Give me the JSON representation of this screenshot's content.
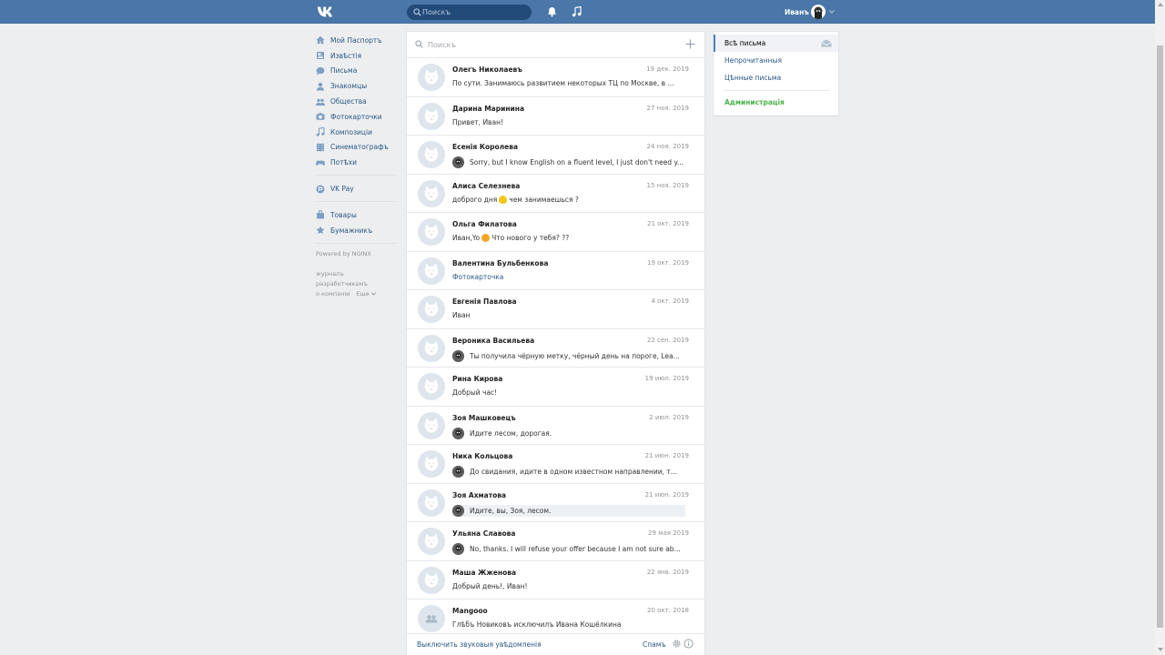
{
  "header": {
    "search_placeholder": "Поискъ",
    "user_name": "Иванъ"
  },
  "sidebar": {
    "items": [
      {
        "label": "Мой Паспортъ",
        "icon": "home-icon"
      },
      {
        "label": "Извѣстія",
        "icon": "news-icon"
      },
      {
        "label": "Письма",
        "icon": "messages-icon"
      },
      {
        "label": "Знакомцы",
        "icon": "friends-icon"
      },
      {
        "label": "Общества",
        "icon": "groups-icon"
      },
      {
        "label": "Фотокарточки",
        "icon": "camera-icon"
      },
      {
        "label": "Композиціи",
        "icon": "music-icon"
      },
      {
        "label": "Синематографъ",
        "icon": "video-icon"
      },
      {
        "label": "Потѣхи",
        "icon": "gamepad-icon"
      }
    ],
    "pay": {
      "label": "VK Pay",
      "icon": "vkpay-icon"
    },
    "extra": [
      {
        "label": "Товары",
        "icon": "bag-icon"
      },
      {
        "label": "Бумажникъ",
        "icon": "star-icon"
      }
    ],
    "powered": "Powered by NGINX",
    "footer_links": {
      "blog": "журналъ",
      "devs": "разработчикамъ",
      "about": "о компаніи",
      "more": "Еще"
    }
  },
  "messages": {
    "search_placeholder": "Поискъ",
    "conversations": [
      {
        "name": "Олегъ Николаевъ",
        "date": "19 дек. 2019",
        "preview": "По сути. Занимаюсь развитием некоторых ТЦ по Москве, в ...",
        "own": false
      },
      {
        "name": "Дарина Маринина",
        "date": "27 ноя. 2019",
        "preview": "Привет, Иван!",
        "own": false
      },
      {
        "name": "Есенія Королева",
        "date": "24 ноя. 2019",
        "preview": "Sorry, but I know English on a fluent level, I just don't need y...",
        "own": true
      },
      {
        "name": "Алиса Селезнева",
        "date": "15 ноя. 2019",
        "preview_before": "доброго дня",
        "preview_after": "чем занимаешься ?",
        "emoji": "yellow-heart-emoji",
        "own": false
      },
      {
        "name": "Ольга Филатова",
        "date": "21 окт. 2019",
        "preview_before": "Иван,Yo",
        "preview_after": "Что нового у тебя? ??",
        "emoji": "smile-emoji",
        "own": false
      },
      {
        "name": "Валентина Бульбенкова",
        "date": "19 окт. 2019",
        "preview": "Фотокарточка",
        "own": false,
        "link": true
      },
      {
        "name": "Евгенія Павлова",
        "date": "4 окт. 2019",
        "preview": "Иван",
        "own": false
      },
      {
        "name": "Вероника Васильева",
        "date": "22 сен. 2019",
        "preview": "Ты получила чёрную метку, чёрный день на пороге, Lea...",
        "own": true
      },
      {
        "name": "Рина Кирова",
        "date": "19 июл. 2019",
        "preview": "Добрый час!",
        "own": false
      },
      {
        "name": "Зоя Машковецъ",
        "date": "2 июл. 2019",
        "preview": "Идите лесом, дорогая.",
        "own": true
      },
      {
        "name": "Ника Кольцова",
        "date": "21 июн. 2019",
        "preview": "До свидания, идите в одном известном направлении, т...",
        "own": true
      },
      {
        "name": "Зоя Ахматова",
        "date": "21 июн. 2019",
        "preview": "Идите, вы, Зоя, лесом.",
        "own": true,
        "unread": true
      },
      {
        "name": "Ульяна Славова",
        "date": "29 мая 2019",
        "preview": "No, thanks. I will refuse your offer because I am not sure ab...",
        "own": true
      },
      {
        "name": "Маша Жженова",
        "date": "22 янв. 2019",
        "preview": "Добрый день!, Иван!",
        "own": false
      },
      {
        "name": "Mangooo",
        "date": "20 окт. 2018",
        "preview": "Глѣбъ Новиковъ исключилъ Ивана Кошёлкина",
        "own": false,
        "group": true
      }
    ],
    "footer": {
      "sound_toggle": "Выключить звуковыя увѣдомленія",
      "spam": "Спамъ"
    }
  },
  "folders": {
    "items": [
      {
        "label": "Всѣ письма",
        "active": true
      },
      {
        "label": "Непрочитанныя",
        "active": false
      },
      {
        "label": "Цѣнные письма",
        "active": false
      }
    ],
    "admin": "Администрація"
  },
  "colors": {
    "header": "#4a76a8",
    "link": "#2a5885",
    "admin": "#4bb34b",
    "background": "#edeef0"
  }
}
